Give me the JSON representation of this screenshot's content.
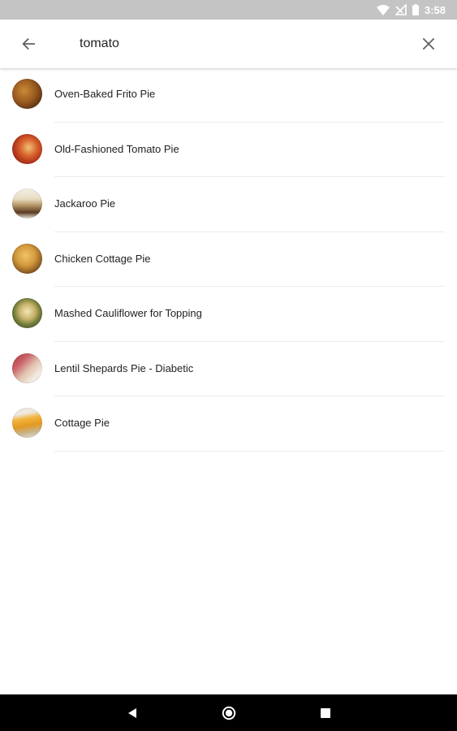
{
  "status_bar": {
    "time": "3:58",
    "icons": [
      "wifi-icon",
      "no-signal-icon",
      "battery-icon"
    ]
  },
  "search": {
    "query": "tomato",
    "back_icon": "arrow-left-icon",
    "clear_icon": "close-icon"
  },
  "results": [
    {
      "title": "Oven-Baked Frito Pie",
      "thumb_icon": "recipe-photo"
    },
    {
      "title": "Old-Fashioned Tomato Pie",
      "thumb_icon": "recipe-photo"
    },
    {
      "title": "Jackaroo Pie",
      "thumb_icon": "recipe-photo"
    },
    {
      "title": "Chicken Cottage Pie",
      "thumb_icon": "recipe-photo"
    },
    {
      "title": "Mashed Cauliflower for Topping",
      "thumb_icon": "recipe-photo"
    },
    {
      "title": "Lentil Shepards Pie - Diabetic",
      "thumb_icon": "recipe-photo"
    },
    {
      "title": "Cottage Pie",
      "thumb_icon": "recipe-photo"
    }
  ],
  "nav_bar": {
    "icons": [
      "back-triangle-icon",
      "home-circle-icon",
      "recents-square-icon"
    ]
  },
  "colors": {
    "status_bar_bg": "#c4c4c4",
    "nav_bar_bg": "#000000",
    "text": "#222222",
    "icon_gray": "#616161",
    "divider": "#ececec"
  }
}
